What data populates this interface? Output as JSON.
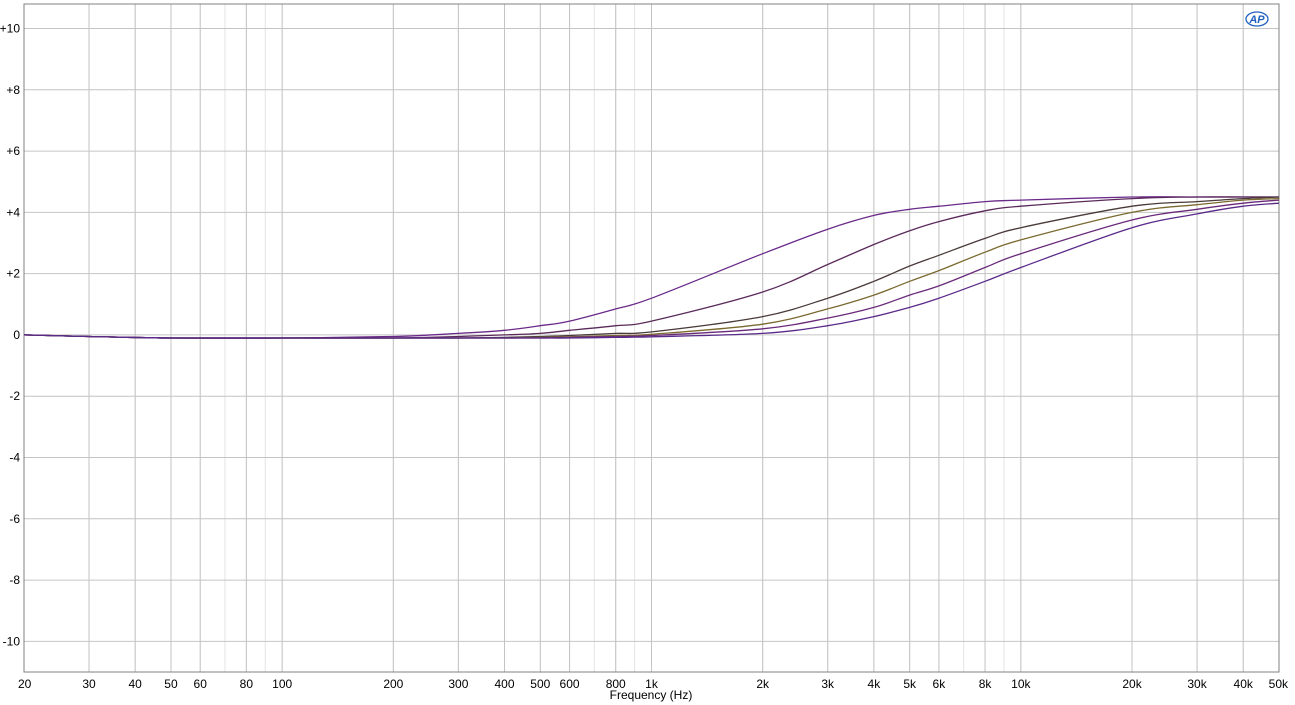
{
  "chart_data": {
    "type": "line",
    "title": "",
    "xlabel": "Frequency (Hz)",
    "ylabel": "",
    "x_scale": "log",
    "xlim": [
      20,
      50000
    ],
    "ylim": [
      -11,
      10.8
    ],
    "grid": true,
    "x_tick_values": [
      20,
      30,
      40,
      50,
      60,
      80,
      100,
      200,
      300,
      400,
      500,
      600,
      800,
      1000,
      2000,
      3000,
      4000,
      5000,
      6000,
      8000,
      10000,
      20000,
      30000,
      40000,
      50000
    ],
    "x_tick_labels": [
      "20",
      "30",
      "40",
      "50",
      "60",
      "80",
      "100",
      "200",
      "300",
      "400",
      "500",
      "600",
      "800",
      "1k",
      "2k",
      "3k",
      "4k",
      "5k",
      "6k",
      "8k",
      "10k",
      "20k",
      "30k",
      "40k",
      "50k"
    ],
    "y_tick_values": [
      10,
      8,
      6,
      4,
      2,
      0,
      -2,
      -4,
      -6,
      -8,
      -10
    ],
    "y_tick_labels": [
      "+10",
      "+8",
      "+6",
      "+4",
      "+2",
      "0",
      "-2",
      "-4",
      "-6",
      "-8",
      "-10"
    ],
    "series": [
      {
        "color": "#6a2a8a",
        "x": [
          20,
          30,
          50,
          100,
          200,
          300,
          400,
          500,
          600,
          800,
          1000,
          2000,
          3000,
          4000,
          5000,
          6000,
          8000,
          10000,
          20000,
          30000,
          40000,
          50000
        ],
        "y": [
          0,
          -0.05,
          -0.1,
          -0.1,
          -0.05,
          0.05,
          0.15,
          0.3,
          0.45,
          0.85,
          1.2,
          2.65,
          3.45,
          3.9,
          4.1,
          4.2,
          4.35,
          4.4,
          4.5,
          4.5,
          4.5,
          4.5
        ]
      },
      {
        "color": "#5a2a5a",
        "x": [
          20,
          30,
          50,
          100,
          200,
          300,
          400,
          500,
          600,
          800,
          1000,
          2000,
          3000,
          4000,
          5000,
          6000,
          8000,
          10000,
          20000,
          30000,
          40000,
          50000
        ],
        "y": [
          0,
          -0.05,
          -0.1,
          -0.1,
          -0.1,
          -0.05,
          0,
          0.05,
          0.15,
          0.3,
          0.45,
          1.4,
          2.3,
          2.95,
          3.4,
          3.7,
          4.05,
          4.2,
          4.45,
          4.5,
          4.5,
          4.5
        ]
      },
      {
        "color": "#4a3a3a",
        "x": [
          20,
          30,
          50,
          100,
          200,
          300,
          400,
          500,
          600,
          800,
          1000,
          2000,
          3000,
          4000,
          5000,
          6000,
          8000,
          10000,
          20000,
          30000,
          40000,
          50000
        ],
        "y": [
          0,
          -0.05,
          -0.1,
          -0.1,
          -0.1,
          -0.1,
          -0.08,
          -0.05,
          -0.02,
          0.05,
          0.1,
          0.6,
          1.2,
          1.75,
          2.25,
          2.6,
          3.15,
          3.5,
          4.2,
          4.35,
          4.45,
          4.5
        ]
      },
      {
        "color": "#7a6a30",
        "x": [
          20,
          30,
          50,
          100,
          200,
          300,
          400,
          500,
          600,
          800,
          1000,
          2000,
          3000,
          4000,
          5000,
          6000,
          8000,
          10000,
          20000,
          30000,
          40000,
          50000
        ],
        "y": [
          0,
          -0.05,
          -0.1,
          -0.1,
          -0.1,
          -0.1,
          -0.1,
          -0.08,
          -0.06,
          -0.02,
          0.02,
          0.35,
          0.85,
          1.3,
          1.75,
          2.1,
          2.7,
          3.1,
          4.0,
          4.25,
          4.4,
          4.45
        ]
      },
      {
        "color": "#6a2a7a",
        "x": [
          20,
          30,
          50,
          100,
          200,
          300,
          400,
          500,
          600,
          800,
          1000,
          2000,
          3000,
          4000,
          5000,
          6000,
          8000,
          10000,
          20000,
          30000,
          40000,
          50000
        ],
        "y": [
          0,
          -0.05,
          -0.1,
          -0.1,
          -0.1,
          -0.1,
          -0.1,
          -0.1,
          -0.08,
          -0.05,
          -0.02,
          0.2,
          0.55,
          0.9,
          1.3,
          1.6,
          2.2,
          2.65,
          3.75,
          4.1,
          4.3,
          4.4
        ]
      },
      {
        "color": "#5a2a8a",
        "x": [
          20,
          30,
          50,
          100,
          200,
          300,
          400,
          500,
          600,
          800,
          1000,
          2000,
          3000,
          4000,
          5000,
          6000,
          8000,
          10000,
          20000,
          30000,
          40000,
          50000
        ],
        "y": [
          0,
          -0.05,
          -0.1,
          -0.1,
          -0.1,
          -0.1,
          -0.1,
          -0.1,
          -0.1,
          -0.08,
          -0.06,
          0.05,
          0.3,
          0.6,
          0.9,
          1.2,
          1.75,
          2.2,
          3.5,
          3.95,
          4.2,
          4.3
        ]
      }
    ]
  },
  "logo": {
    "text": "AP",
    "color": "#2060c0"
  }
}
